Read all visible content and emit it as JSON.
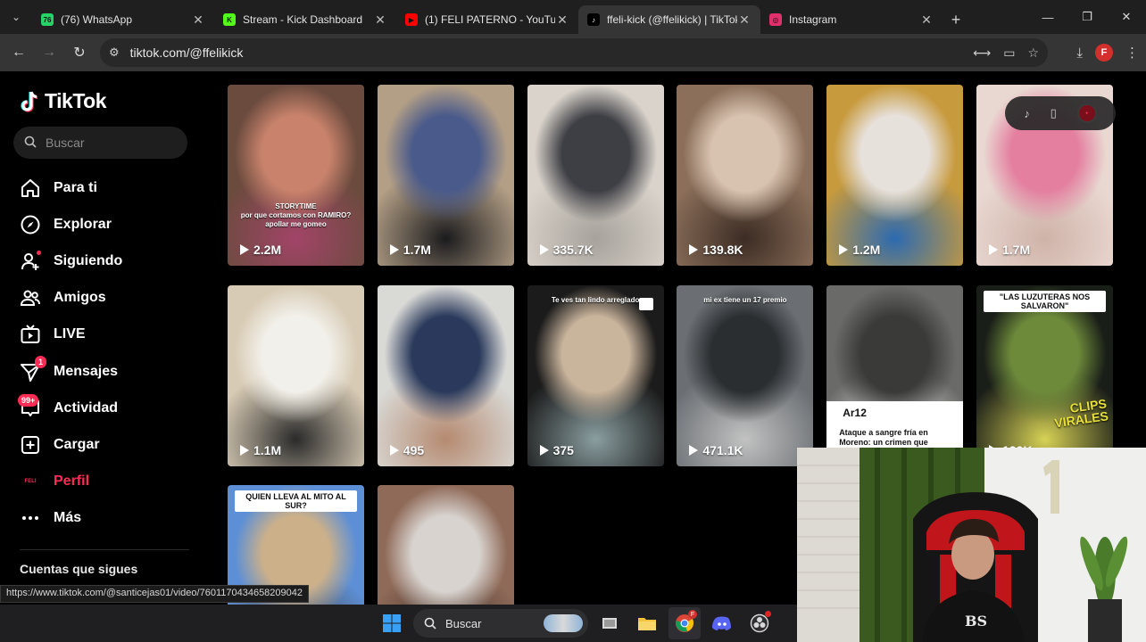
{
  "browser": {
    "tabs": [
      {
        "title": "(76) WhatsApp",
        "favicon": "whatsapp-icon",
        "favicon_color": "#25d366",
        "favicon_text": "76",
        "active": false
      },
      {
        "title": "Stream - Kick Dashboard",
        "favicon": "kick-icon",
        "favicon_color": "#53fc18",
        "favicon_text": "K",
        "active": false
      },
      {
        "title": "(1) FELI PATERNO - YouTube",
        "favicon": "youtube-icon",
        "favicon_color": "#ff0000",
        "favicon_text": "▶",
        "active": false
      },
      {
        "title": "ffeli-kick (@ffelikick) | TikTok",
        "favicon": "tiktok-icon",
        "favicon_color": "#000000",
        "favicon_text": "♪",
        "active": true
      },
      {
        "title": "Instagram",
        "favicon": "instagram-icon",
        "favicon_color": "#e1306c",
        "favicon_text": "◎",
        "active": false
      }
    ],
    "url": "tiktok.com/@ffelikick",
    "status_url": "https://www.tiktok.com/@santicejas01/video/7601170434658209042"
  },
  "tiktok": {
    "brand": "TikTok",
    "search_placeholder": "Buscar",
    "nav": [
      {
        "key": "for-you",
        "label": "Para ti",
        "icon": "home-icon"
      },
      {
        "key": "explore",
        "label": "Explorar",
        "icon": "compass-icon"
      },
      {
        "key": "following",
        "label": "Siguiendo",
        "icon": "user-plus-icon",
        "dot": true
      },
      {
        "key": "friends",
        "label": "Amigos",
        "icon": "friends-icon"
      },
      {
        "key": "live",
        "label": "LIVE",
        "icon": "live-tv-icon"
      },
      {
        "key": "messages",
        "label": "Mensajes",
        "icon": "send-icon",
        "badge": "1"
      },
      {
        "key": "activity",
        "label": "Actividad",
        "icon": "inbox-icon",
        "badge": "99+"
      },
      {
        "key": "upload",
        "label": "Cargar",
        "icon": "plus-square-icon"
      },
      {
        "key": "profile",
        "label": "Perfil",
        "icon": "profile-avatar-icon",
        "active": true,
        "avatar_text": "FELI"
      },
      {
        "key": "more",
        "label": "Más",
        "icon": "more-dots-icon"
      }
    ],
    "following_heading": "Cuentas que sigues",
    "videos": [
      {
        "views": "2.2M",
        "caption": "STORYTIME\npor que cortamos con RAMIRO?\napollar me gomeo",
        "colors": [
          "#6b4b3e",
          "#c9836c",
          "#a24468"
        ]
      },
      {
        "views": "1.7M",
        "caption": "",
        "colors": [
          "#b39f86",
          "#4a5a8a",
          "#1b1b1d"
        ]
      },
      {
        "views": "335.7K",
        "caption": "",
        "colors": [
          "#d9d3cb",
          "#3e3f45",
          "#a7a29b"
        ]
      },
      {
        "views": "139.8K",
        "caption": "",
        "colors": [
          "#8b6f5a",
          "#d8c3b0",
          "#3c2c24"
        ]
      },
      {
        "views": "1.2M",
        "caption": "",
        "colors": [
          "#c79a3d",
          "#e7e1dc",
          "#2c6ab0"
        ]
      },
      {
        "views": "1.7M",
        "caption": "",
        "colors": [
          "#e9d8d2",
          "#e47fa0",
          "#cfb3a8"
        ]
      },
      {
        "views": "1.1M",
        "caption": "",
        "colors": [
          "#d8cbb5",
          "#f2f0ea",
          "#2a2a2a"
        ]
      },
      {
        "views": "495",
        "caption": "",
        "colors": [
          "#d9d9d6",
          "#2b3a5c",
          "#b58a70"
        ]
      },
      {
        "views": "375",
        "caption": "Te ves tan lindo arreglado",
        "colors": [
          "#1b1b1b",
          "#c9b49c",
          "#8a9ea0"
        ]
      },
      {
        "views": "471.1K",
        "caption": "mi ex tiene un 17 premio",
        "colors": [
          "#6b6f73",
          "#2b2e31",
          "#c2c2c2"
        ]
      },
      {
        "views": "",
        "caption": "Ataque a sangre fría en Moreno: un crimen que",
        "banner_left": "Ar12",
        "colors": [
          "#6a6a68",
          "#3a3a38",
          "#f2f2f2"
        ]
      },
      {
        "views": "120K",
        "caption": "",
        "banner": "\"LAS LUZUTERAS NOS SALVARON\"",
        "sticker": "CLIPS VIRALES",
        "colors": [
          "#1a1e18",
          "#6d8a3a",
          "#d7d255"
        ]
      },
      {
        "views": "",
        "caption": "",
        "banner": "QUIEN LLEVA AL MITO AL SUR?",
        "colors": [
          "#5c8fd6",
          "#cbb08a",
          "#4a3f33"
        ]
      },
      {
        "views": "",
        "caption": "",
        "colors": [
          "#8f6a58",
          "#d8d3cf",
          "#3a2f2a"
        ]
      }
    ]
  },
  "taskbar": {
    "search_label": "Buscar",
    "apps": [
      "windows-start-icon",
      "search-icon",
      "widgets-icon",
      "task-view-icon",
      "file-explorer-icon",
      "chrome-icon",
      "discord-icon",
      "obs-icon"
    ]
  },
  "colors": {
    "accent": "#fe2c55",
    "bg": "#000000",
    "chrome_tab_bg": "#1f1f1f",
    "chrome_toolbar": "#353535"
  }
}
